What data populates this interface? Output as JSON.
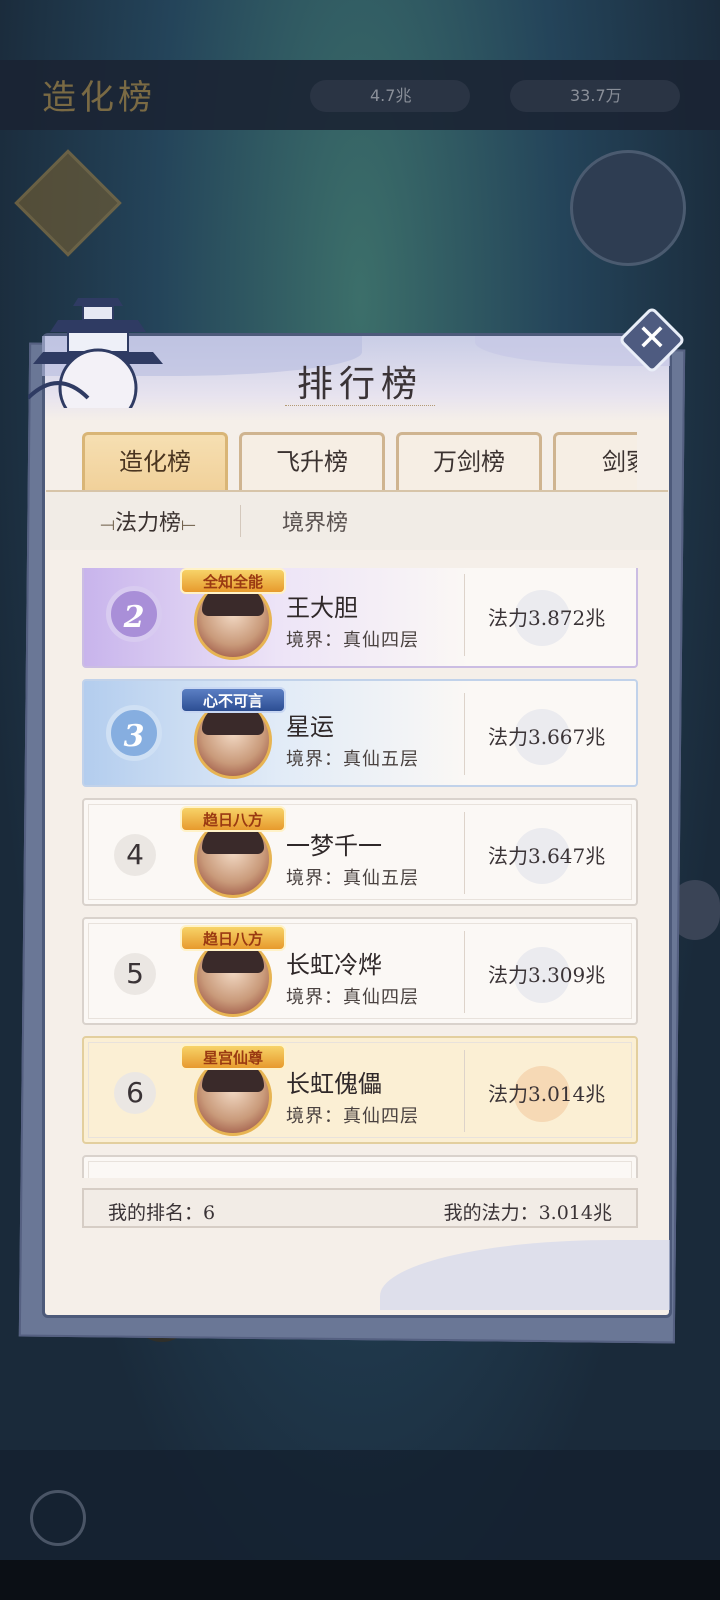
{
  "background": {
    "title": "造化榜",
    "resource_1": "4.7兆",
    "resource_2": "33.7万"
  },
  "modal": {
    "title": "排行榜",
    "close_label": "✕"
  },
  "tabs": [
    {
      "label": "造化榜",
      "active": true
    },
    {
      "label": "飞升榜",
      "active": false
    },
    {
      "label": "万剑榜",
      "active": false
    },
    {
      "label": "剑冢",
      "active": false
    }
  ],
  "subtabs": [
    {
      "label": "法力榜",
      "active": true
    },
    {
      "label": "境界榜",
      "active": false
    }
  ],
  "rankings": [
    {
      "rank": "2",
      "badge": "全知全能",
      "name": "王大胆",
      "realm": "境界：真仙四层",
      "power": "法力3.872兆"
    },
    {
      "rank": "3",
      "badge": "心不可言",
      "name": "星运",
      "realm": "境界：真仙五层",
      "power": "法力3.667兆"
    },
    {
      "rank": "4",
      "badge": "趋日八方",
      "name": "一梦千一",
      "realm": "境界：真仙五层",
      "power": "法力3.647兆"
    },
    {
      "rank": "5",
      "badge": "趋日八方",
      "name": "长虹冷烨",
      "realm": "境界：真仙四层",
      "power": "法力3.309兆"
    },
    {
      "rank": "6",
      "badge": "星宫仙尊",
      "name": "长虹傀儡",
      "realm": "境界：真仙四层",
      "power": "法力3.014兆"
    }
  ],
  "footer": {
    "my_rank": "我的排名：6",
    "my_power": "我的法力：3.014兆"
  },
  "colors": {
    "modal_border": "#4d5a7a",
    "tab_active": "#f1d19a",
    "rank2": "#a98fd8",
    "rank3": "#86aee0",
    "self_row": "#fbefd4"
  }
}
